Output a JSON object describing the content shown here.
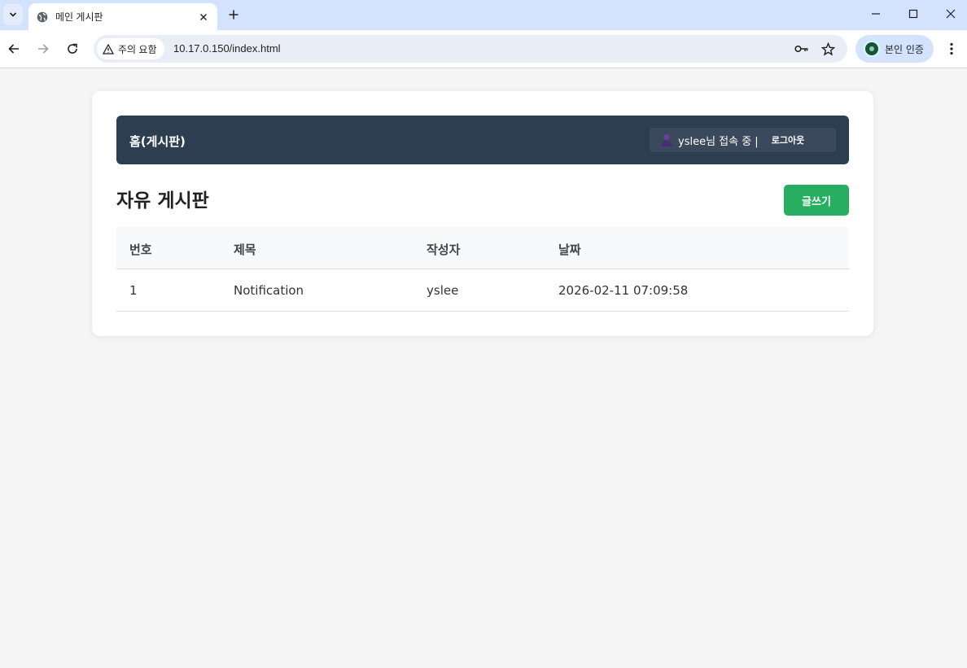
{
  "browser": {
    "tab_title": "메인 게시판",
    "security_label": "주의 요함",
    "url": "10.17.0.150/index.html",
    "profile_label": "본인 인증"
  },
  "page": {
    "home_link": "홈(게시판)",
    "user_status": "yslee님 접속 중 |",
    "logout_label": "로그아웃",
    "board_title": "자유 게시판",
    "write_button": "글쓰기",
    "table": {
      "headers": {
        "no": "번호",
        "title": "제목",
        "author": "작성자",
        "date": "날짜"
      },
      "rows": [
        {
          "no": "1",
          "title": "Notification",
          "author": "yslee",
          "date": "2026-02-11 07:09:58"
        }
      ]
    }
  },
  "colors": {
    "header_bg": "#2d3e50",
    "write_button": "#27ae60",
    "tabbar": "#d3e3fd"
  }
}
